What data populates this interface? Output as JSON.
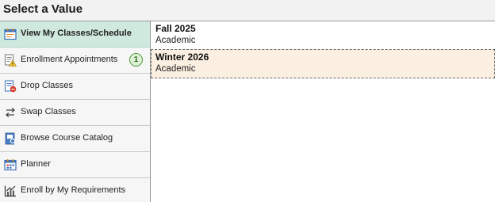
{
  "header": {
    "title": "Select a Value"
  },
  "sidebar": {
    "items": [
      {
        "label": "View My Classes/Schedule",
        "icon": "calendar-icon",
        "active": true
      },
      {
        "label": "Enrollment Appointments",
        "icon": "appointment-warning-icon",
        "badge": "1"
      },
      {
        "label": "Drop Classes",
        "icon": "drop-classes-icon"
      },
      {
        "label": "Swap Classes",
        "icon": "swap-arrows-icon"
      },
      {
        "label": "Browse Course Catalog",
        "icon": "catalog-book-icon"
      },
      {
        "label": "Planner",
        "icon": "planner-calendar-icon"
      },
      {
        "label": "Enroll by My Requirements",
        "icon": "requirements-chart-icon"
      }
    ]
  },
  "terms": [
    {
      "name": "Fall 2025",
      "career": "Academic",
      "selected": false
    },
    {
      "name": "Winter 2026",
      "career": "Academic",
      "selected": true
    }
  ],
  "colors": {
    "active_nav_bg": "#cfe9de",
    "selected_row_bg": "#fbefe1",
    "badge_border": "#5a9b3c"
  }
}
